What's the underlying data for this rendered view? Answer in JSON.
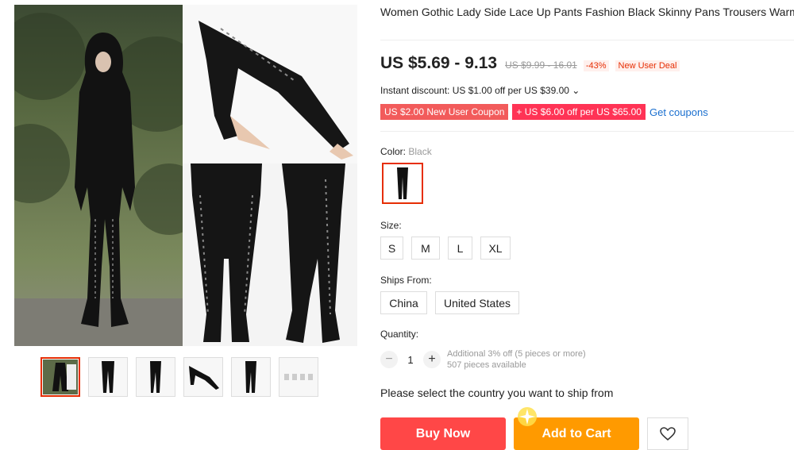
{
  "product": {
    "title": "Women Gothic Lady Side Lace Up Pants Fashion Black Skinny Pans Trousers Warme Fit Print Sporting Workout Athletic Leggins",
    "price": "US $5.69 - 9.13",
    "original_price": "US $9.99 - 16.01",
    "discount": "-43%",
    "deal_badge": "New User Deal",
    "instant_discount": "Instant discount: US $1.00 off per US $39.00 ⌄",
    "coupons": [
      "US $2.00 New User Coupon",
      "+ US $6.00 off per US $65.00"
    ],
    "get_coupons": "Get coupons"
  },
  "color": {
    "label": "Color:",
    "selected": "Black"
  },
  "size": {
    "label": "Size:",
    "options": [
      "S",
      "M",
      "L",
      "XL"
    ]
  },
  "ships_from": {
    "label": "Ships From:",
    "options": [
      "China",
      "United States"
    ]
  },
  "quantity": {
    "label": "Quantity:",
    "minus": "−",
    "value": "1",
    "plus": "+",
    "info_line1": "Additional 3% off (5 pieces or more)",
    "info_line2": "507 pieces available"
  },
  "ship_message": "Please select the country you want to ship from",
  "actions": {
    "buy_now": "Buy Now",
    "add_to_cart": "Add to Cart"
  },
  "colors": {
    "accent": "#e62e04",
    "buy": "#ff4747",
    "cart": "#ff9a00",
    "link": "#1a6fcf"
  },
  "icons": {
    "wishlist": "heart-icon"
  }
}
